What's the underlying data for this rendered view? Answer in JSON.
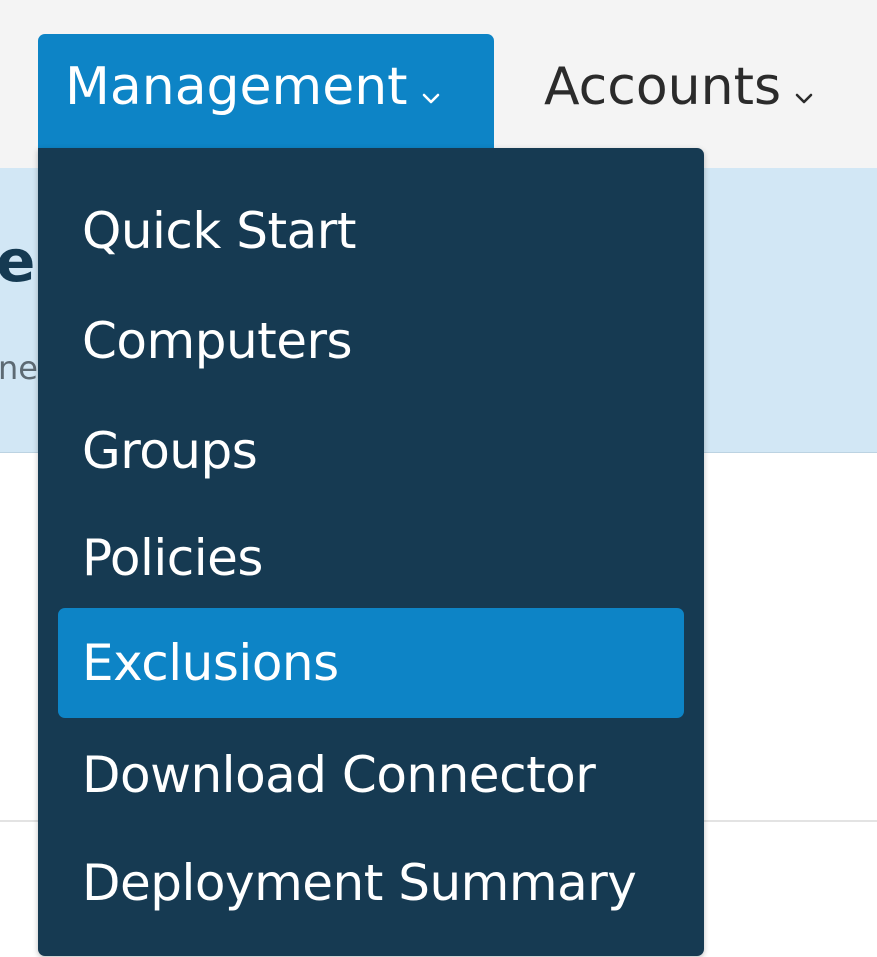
{
  "nav": {
    "management_label": "Management",
    "accounts_label": "Accounts"
  },
  "header": {
    "title_fragment": "e",
    "subtitle_fragment": "ne"
  },
  "dropdown": {
    "items": [
      {
        "label": "Quick Start",
        "active": false
      },
      {
        "label": "Computers",
        "active": false
      },
      {
        "label": "Groups",
        "active": false
      },
      {
        "label": "Policies",
        "active": false
      },
      {
        "label": "Exclusions",
        "active": true
      },
      {
        "label": "Download Connector",
        "active": false
      },
      {
        "label": "Deployment Summary",
        "active": false
      }
    ]
  },
  "colors": {
    "accent": "#0d84c6",
    "menu_background": "#163a52",
    "header_band": "#d2e7f5",
    "navbar": "#f4f4f4"
  },
  "icons": {
    "management_chevron": "chevron-down-icon",
    "accounts_chevron": "chevron-down-icon"
  }
}
